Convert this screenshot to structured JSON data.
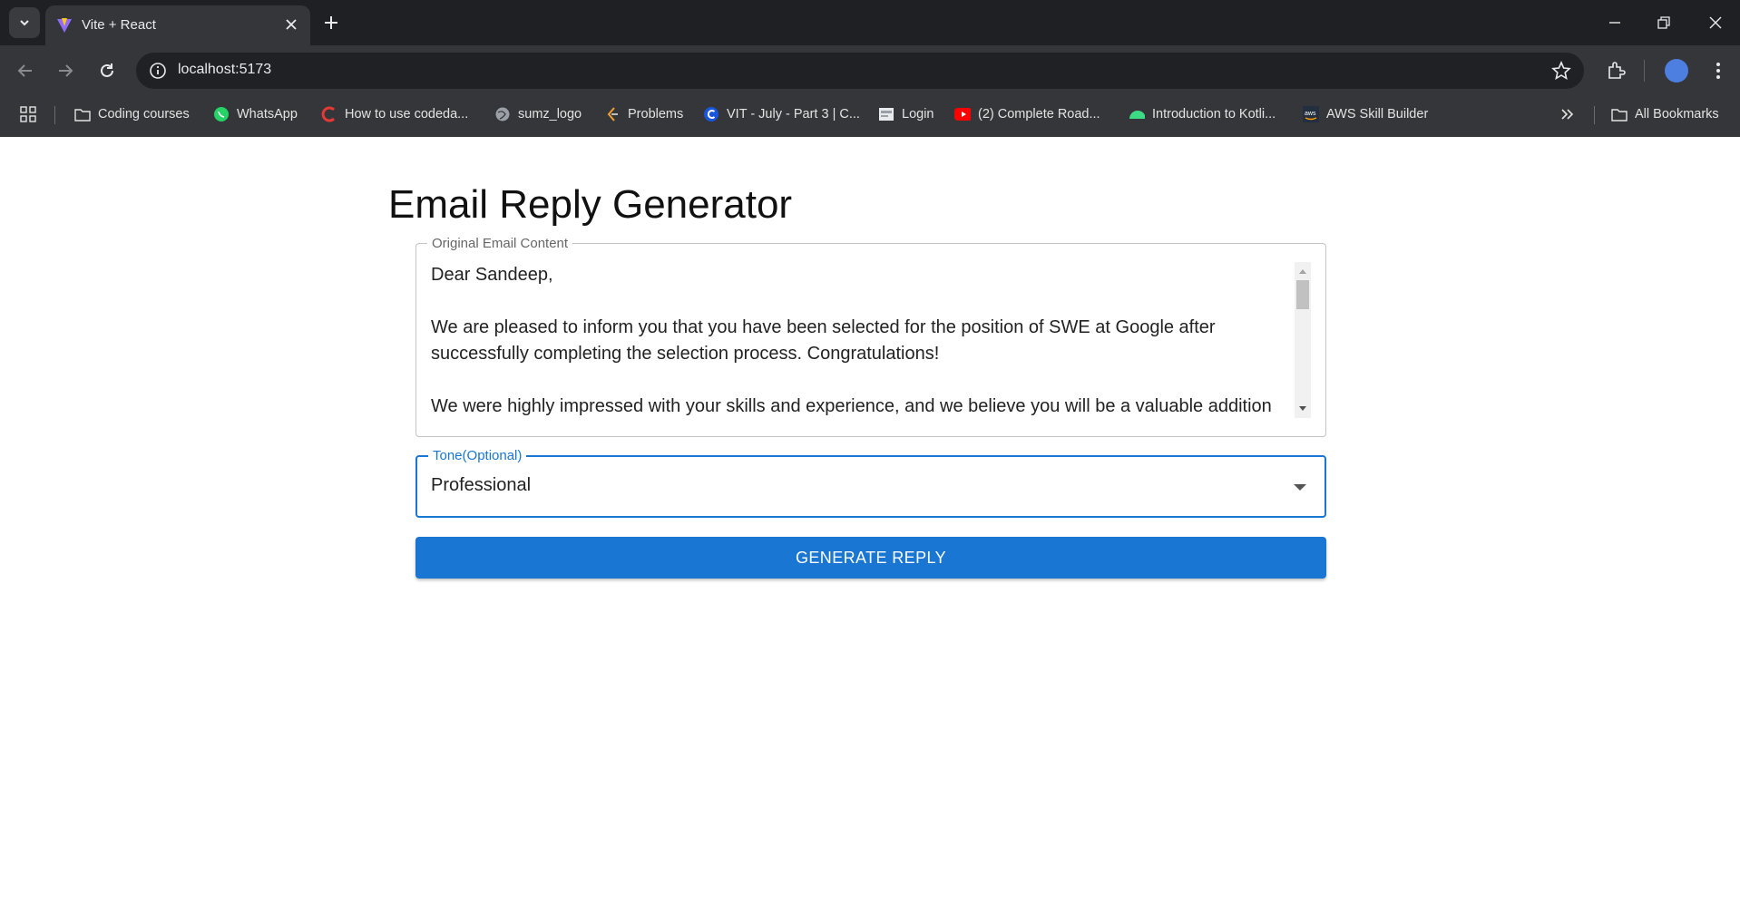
{
  "browser": {
    "tab": {
      "title": "Vite + React"
    },
    "address": {
      "url": "localhost:5173"
    },
    "bookmarks": [
      {
        "label": "Coding courses",
        "icon": "folder-icon"
      },
      {
        "label": "WhatsApp",
        "icon": "whatsapp-icon"
      },
      {
        "label": "How to use codeda...",
        "icon": "codedamn-icon"
      },
      {
        "label": "sumz_logo",
        "icon": "globe-icon"
      },
      {
        "label": "Problems",
        "icon": "problems-icon"
      },
      {
        "label": "VIT - July - Part 3 | C...",
        "icon": "c-icon"
      },
      {
        "label": "Login",
        "icon": "login-icon"
      },
      {
        "label": "(2) Complete Road...",
        "icon": "youtube-icon"
      },
      {
        "label": "Introduction to Kotli...",
        "icon": "android-icon"
      },
      {
        "label": "AWS Skill Builder",
        "icon": "aws-icon"
      }
    ],
    "all_bookmarks_label": "All Bookmarks"
  },
  "app": {
    "title": "Email Reply Generator",
    "email_field": {
      "label": "Original Email Content",
      "paragraphs": [
        "Dear Sandeep,",
        "We are pleased to inform you that you have been selected for the position of SWE at Google after successfully completing the selection process. Congratulations!",
        "We were highly impressed with your skills and experience, and we believe you will be a valuable addition"
      ]
    },
    "tone_field": {
      "label": "Tone(Optional)",
      "value": "Professional"
    },
    "generate_button": {
      "label": "GENERATE REPLY"
    }
  },
  "colors": {
    "primary": "#1976d2",
    "chrome_dark": "#1f2023",
    "chrome_toolbar": "#35363a"
  }
}
